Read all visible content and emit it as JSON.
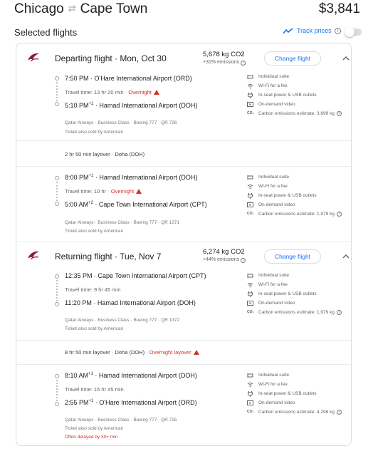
{
  "header": {
    "origin": "Chicago",
    "destination": "Cape Town",
    "swap_icon": "swap-arrows-icon",
    "price": "$3,841"
  },
  "selected": {
    "title": "Selected flights",
    "track_label": "Track prices"
  },
  "departing": {
    "title": "Departing flight · Mon, Oct 30",
    "co2": "5,678 kg CO2",
    "co2_sub": "+31% emissions",
    "change_label": "Change flight",
    "leg1": {
      "dep_time": "7:50 PM",
      "dep_sup": "",
      "dep_airport": "O'Hare International Airport (ORD)",
      "travel": "Travel time: 13 hr 20 min",
      "overnight": "Overnight",
      "arr_time": "5:10 PM",
      "arr_sup": "+1",
      "arr_airport": "Hamad International Airport (DOH)",
      "details": "Qatar Airways · Business Class · Boeing 777 · QR 726",
      "sold_by": "Ticket also sold by American",
      "amenities": [
        "Individual suite",
        "Wi-Fi for a fee",
        "In-seat power & USB outlets",
        "On-demand video",
        "Carbon emissions estimate: 3,699 kg"
      ]
    },
    "layover": "2 hr 50 min layover · Doha (DOH)",
    "leg2": {
      "dep_time": "8:00 PM",
      "dep_sup": "+1",
      "dep_airport": "Hamad International Airport (DOH)",
      "travel": "Travel time: 10 hr",
      "overnight": "Overnight",
      "arr_time": "5:00 AM",
      "arr_sup": "+2",
      "arr_airport": "Cape Town International Airport (CPT)",
      "details": "Qatar Airways · Business Class · Boeing 777 · QR 1371",
      "sold_by": "Ticket also sold by American",
      "amenities": [
        "Individual suite",
        "Wi-Fi for a fee",
        "In-seat power & USB outlets",
        "On-demand video",
        "Carbon emissions estimate: 1,979 kg"
      ]
    }
  },
  "returning": {
    "title": "Returning flight · Tue, Nov 7",
    "co2": "6,274 kg CO2",
    "co2_sub": "+44% emissions",
    "change_label": "Change flight",
    "leg1": {
      "dep_time": "12:35 PM",
      "dep_sup": "",
      "dep_airport": "Cape Town International Airport (CPT)",
      "travel": "Travel time: 9 hr 45 min",
      "arr_time": "11:20 PM",
      "arr_sup": "",
      "arr_airport": "Hamad International Airport (DOH)",
      "details": "Qatar Airways · Business Class · Boeing 777 · QR 1372",
      "sold_by": "Ticket also sold by American",
      "amenities": [
        "Individual suite",
        "Wi-Fi for a fee",
        "In-seat power & USB outlets",
        "On-demand video",
        "Carbon emissions estimate: 1,979 kg"
      ]
    },
    "layover": "8 hr 50 min layover · Doha (DOH) ·",
    "layover_warn": "Overnight layover",
    "leg2": {
      "dep_time": "8:10 AM",
      "dep_sup": "+1",
      "dep_airport": "Hamad International Airport (DOH)",
      "travel": "Travel time: 15 hr 45 min",
      "arr_time": "2:55 PM",
      "arr_sup": "+1",
      "arr_airport": "O'Hare International Airport (ORD)",
      "details": "Qatar Airways · Business Class · Boeing 777 · QR 725",
      "sold_by": "Ticket also sold by American",
      "delay": "Often delayed by 30+ min",
      "amenities": [
        "Individual suite",
        "Wi-Fi for a fee",
        "In-seat power & USB outlets",
        "On-demand video",
        "Carbon emissions estimate: 4,296 kg"
      ]
    }
  },
  "colors": {
    "accent": "#1a73e8",
    "warning": "#d93025",
    "airline": "#8d1b3d"
  }
}
